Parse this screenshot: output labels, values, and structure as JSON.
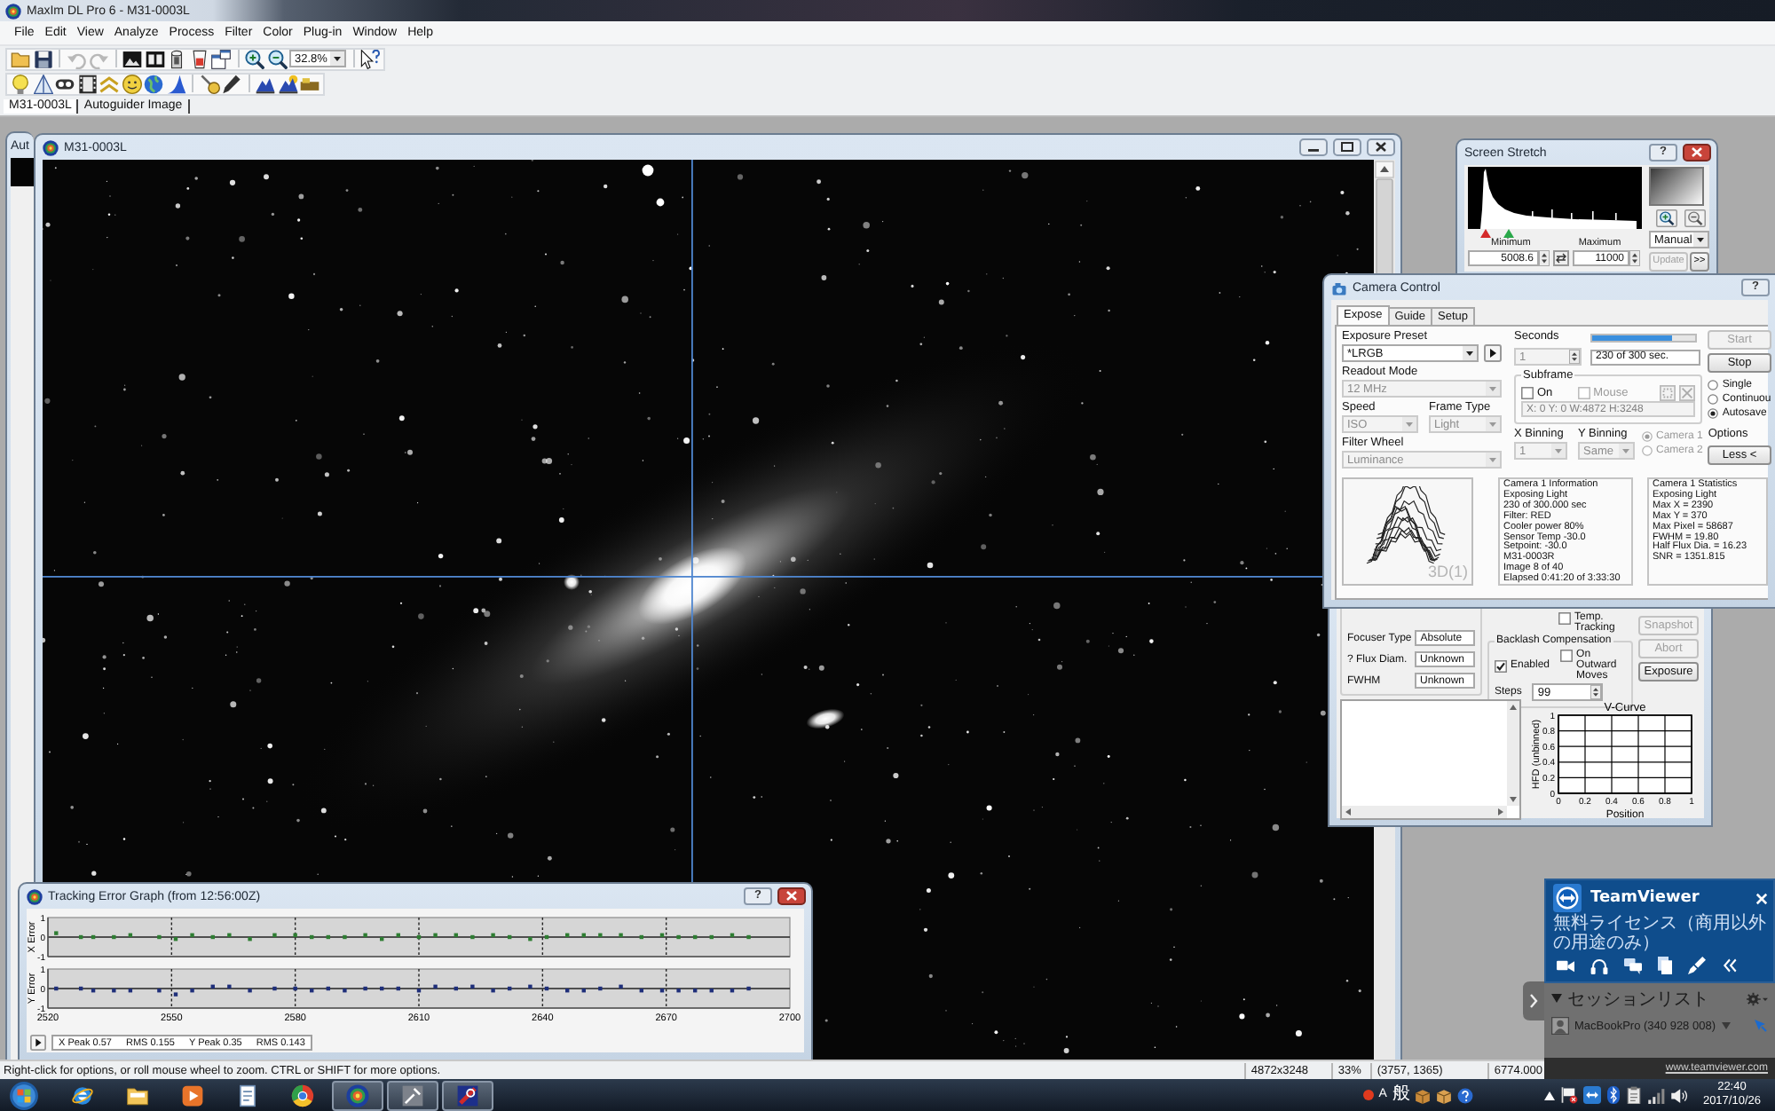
{
  "window": {
    "title": "MaxIm DL Pro 6 - M31-0003L"
  },
  "menu": [
    "File",
    "Edit",
    "View",
    "Analyze",
    "Process",
    "Filter",
    "Color",
    "Plug-in",
    "Window",
    "Help"
  ],
  "toolbar": {
    "undo": {
      "disabled": true
    },
    "redo": {
      "disabled": true
    },
    "zoom": "32.8%"
  },
  "document_tabs": [
    {
      "label": "M31-0003L",
      "selected": true
    },
    {
      "label": "Autoguider Image",
      "selected": false
    }
  ],
  "autoguider_window": {
    "title": "Aut"
  },
  "image_window": {
    "title": "M31-0003L"
  },
  "screen_stretch": {
    "title": "Screen Stretch",
    "help": "?",
    "minimum_label": "Minimum",
    "maximum_label": "Maximum",
    "minimum": "5008.6",
    "maximum": "11000",
    "mode": "Manual",
    "update": {
      "label": "Update",
      "disabled": true
    },
    "expand": ">>"
  },
  "camera_control": {
    "title": "Camera Control",
    "help": "?",
    "tabs": [
      {
        "label": "Expose",
        "selected": true
      },
      {
        "label": "Guide",
        "selected": false
      },
      {
        "label": "Setup",
        "selected": false
      }
    ],
    "exposure_preset": {
      "label": "Exposure Preset",
      "value": "*LRGB",
      "disabled": false
    },
    "readout_mode": {
      "label": "Readout Mode",
      "value": "12 MHz",
      "disabled": true
    },
    "speed": {
      "label": "Speed",
      "value": "ISO",
      "disabled": true
    },
    "frame_type": {
      "label": "Frame Type",
      "value": "Light",
      "disabled": true
    },
    "filter_wheel": {
      "label": "Filter Wheel",
      "value": "Luminance",
      "disabled": true
    },
    "seconds": {
      "label": "Seconds",
      "value": "1",
      "disabled": true
    },
    "progress": {
      "level": 0.77,
      "text": "230 of 300 sec."
    },
    "subframe": {
      "label": "Subframe",
      "on": {
        "label": "On",
        "checked": false,
        "disabled": false
      },
      "mouse": {
        "label": "Mouse",
        "checked": false,
        "disabled": true
      },
      "region": {
        "value": "X: 0 Y: 0 W:4872 H:3248",
        "disabled": true
      }
    },
    "x_binning": {
      "label": "X Binning",
      "value": "1",
      "disabled": true
    },
    "y_binning": {
      "label": "Y Binning",
      "value": "Same",
      "disabled": true
    },
    "cameras": [
      {
        "label": "Camera 1",
        "selected": true,
        "disabled": true
      },
      {
        "label": "Camera 2",
        "selected": false,
        "disabled": true
      }
    ],
    "start": {
      "label": "Start",
      "disabled": true
    },
    "stop": {
      "label": "Stop",
      "disabled": false
    },
    "modes": [
      {
        "label": "Single",
        "selected": false
      },
      {
        "label": "Continuou",
        "selected": false
      },
      {
        "label": "Autosave",
        "selected": true
      }
    ],
    "options": "Options",
    "less": "Less <",
    "preview_label": "3D(1)",
    "information": [
      "Camera 1 Information",
      "Exposing Light",
      "230 of 300.000 sec",
      "Filter: RED",
      "Cooler power 80%",
      "Sensor Temp -30.0",
      "Setpoint: -30.0",
      "M31-0003R",
      "Image 8 of 40",
      "Elapsed 0:41:20 of 3:33:30"
    ],
    "statistics": [
      "Camera 1 Statistics",
      "Exposing Light",
      "Max X = 2390",
      "Max Y = 370",
      "Max Pixel = 58687",
      "FWHM = 19.80",
      "Half Flux Dia. = 16.23",
      "SNR = 1351.815"
    ]
  },
  "focus_window": {
    "temp_tracking": {
      "label": "Temp. Tracking",
      "checked": false
    },
    "fields": [
      {
        "label": "Focuser Type",
        "value": "Absolute"
      },
      {
        "label": "? Flux Diam.",
        "value": "Unknown"
      },
      {
        "label": "FWHM",
        "value": "Unknown"
      }
    ],
    "backlash": {
      "title": "Backlash Compensation",
      "enabled": {
        "label": "Enabled",
        "checked": true
      },
      "outward": {
        "label": "On Outward Moves",
        "checked": false
      },
      "steps_label": "Steps",
      "steps": "99"
    },
    "buttons": [
      {
        "label": "Snapshot",
        "disabled": true
      },
      {
        "label": "Abort",
        "disabled": true
      },
      {
        "label": "Exposure",
        "disabled": false
      }
    ],
    "v_curve": {
      "chart_data": {
        "type": "line",
        "title": "V-Curve",
        "xlabel": "Position",
        "ylabel": "HFD (unbinned)",
        "xlim": [
          0,
          1
        ],
        "ylim": [
          0,
          1
        ],
        "xticks": [
          0,
          0.2,
          0.4,
          0.6,
          0.8,
          1
        ],
        "yticks": [
          0,
          0.2,
          0.4,
          0.6,
          0.8,
          1
        ],
        "grid": true
      }
    }
  },
  "tracking_graph": {
    "title": "Tracking Error Graph (from 12:56:00Z)",
    "help": "?",
    "x_error": {
      "chart_data": {
        "type": "scatter",
        "ylabel": "X Error",
        "x": [
          2522,
          2528,
          2531,
          2536,
          2540,
          2547,
          2551,
          2555,
          2560,
          2564,
          2569,
          2575,
          2580,
          2584,
          2588,
          2592,
          2597,
          2601,
          2605,
          2610,
          2614,
          2619,
          2623,
          2628,
          2632,
          2637,
          2641,
          2646,
          2650,
          2654,
          2659,
          2664,
          2669,
          2673,
          2677,
          2681,
          2686,
          2690
        ],
        "series": [
          {
            "color": "#2e7d32",
            "values": [
              0.2,
              0,
              0,
              0,
              0.1,
              0,
              -0.1,
              0.1,
              0,
              0.1,
              -0.1,
              0.1,
              0.1,
              0,
              0,
              0,
              0.1,
              -0.1,
              0.1,
              0,
              0.1,
              0.1,
              0,
              0.1,
              0,
              -0.1,
              0,
              0.1,
              0.1,
              0.1,
              0.1,
              0,
              0.1,
              0,
              0,
              0,
              0.1,
              0
            ]
          }
        ],
        "xlim": [
          2520,
          2700
        ],
        "ylim": [
          -1,
          1
        ],
        "yticks": [
          -1,
          0,
          1
        ],
        "grid": true
      }
    },
    "y_error": {
      "chart_data": {
        "type": "scatter",
        "ylabel": "Y Error",
        "x": [
          2522,
          2528,
          2531,
          2536,
          2540,
          2547,
          2551,
          2555,
          2560,
          2564,
          2569,
          2575,
          2580,
          2584,
          2588,
          2592,
          2597,
          2601,
          2605,
          2610,
          2614,
          2619,
          2623,
          2628,
          2632,
          2637,
          2641,
          2646,
          2650,
          2654,
          2659,
          2664,
          2669,
          2673,
          2677,
          2681,
          2686,
          2690
        ],
        "series": [
          {
            "color": "#1f2f7a",
            "values": [
              0,
              0,
              -0.1,
              -0.1,
              -0.1,
              -0.1,
              -0.3,
              -0.1,
              0.1,
              0.1,
              -0.1,
              0,
              0,
              -0.1,
              0,
              -0.1,
              0,
              0,
              0,
              -0.1,
              0.1,
              0,
              0.1,
              -0.1,
              0,
              0.1,
              0,
              -0.1,
              -0.1,
              0,
              0.1,
              -0.1,
              -0.1,
              -0.1,
              -0.1,
              -0.1,
              -0.1,
              0
            ]
          }
        ],
        "xlim": [
          2520,
          2700
        ],
        "ylim": [
          -1,
          1
        ],
        "xticks": [
          2520,
          2550,
          2580,
          2610,
          2640,
          2670,
          2700
        ],
        "yticks": [
          -1,
          0,
          1
        ],
        "grid": true
      }
    },
    "stats": [
      "X Peak 0.57",
      "RMS 0.155",
      "Y Peak 0.35",
      "RMS 0.143"
    ]
  },
  "status_bar": {
    "hint": "Right-click for options, or roll mouse wheel to zoom. CTRL or SHIFT for more options.",
    "fields": [
      "4872x3248",
      "33%",
      "(3757, 1365)",
      "6774.000"
    ]
  },
  "teamviewer": {
    "title": "TeamViewer",
    "license": "無料ライセンス（商用以外の用途のみ）",
    "session_list": {
      "title": "セッションリスト",
      "expanded": true,
      "items": [
        {
          "name": "MacBookPro (340 928 008)"
        }
      ]
    },
    "website": "www.teamviewer.com"
  },
  "taskbar": {
    "apps": [
      {
        "open": false
      },
      {
        "open": false
      },
      {
        "open": false
      },
      {
        "open": false
      },
      {
        "open": false
      },
      {
        "open": true
      },
      {
        "open": true
      },
      {
        "open": true
      }
    ],
    "ime_mode": "A",
    "ime_conversion": "般",
    "time": "22:40",
    "date": "2017/10/26"
  }
}
